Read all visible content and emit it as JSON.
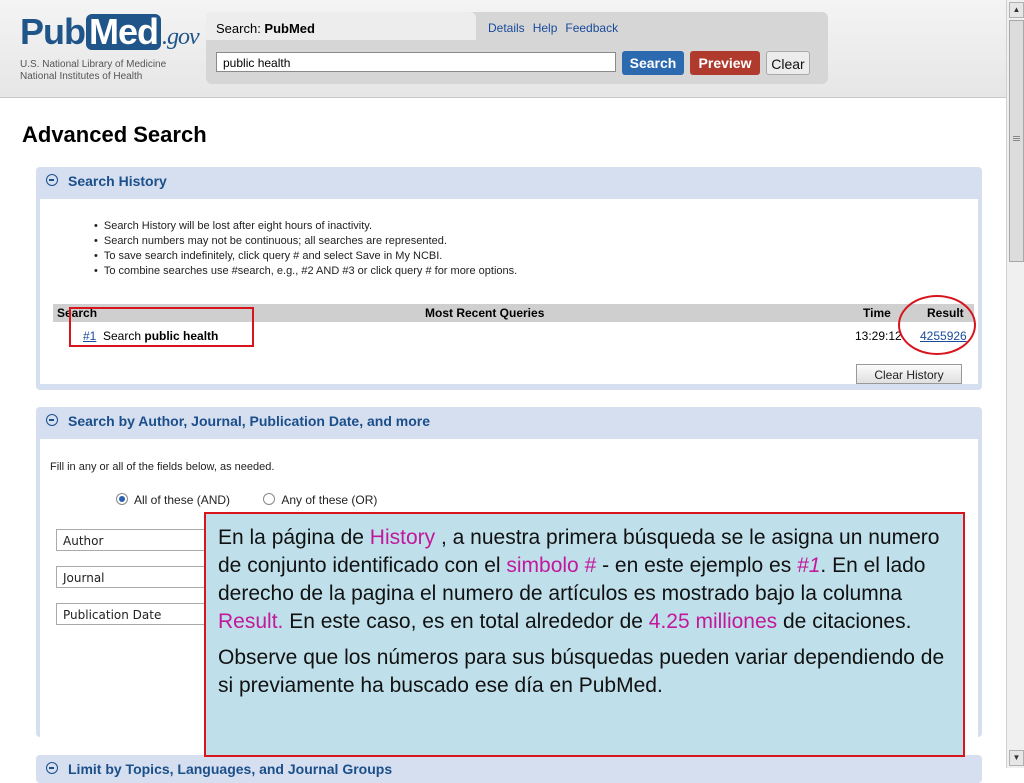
{
  "header": {
    "logo": {
      "pub": "Pub",
      "med": "Med",
      "gov": ".gov",
      "sub1": "U.S. National Library of Medicine",
      "sub2": "National Institutes of Health"
    },
    "search": {
      "label_prefix": "Search: ",
      "database": "PubMed",
      "links": [
        "Details",
        "Help",
        "Feedback"
      ],
      "query": "public health",
      "buttons": {
        "search": "Search",
        "preview": "Preview",
        "clear": "Clear"
      }
    }
  },
  "page_title": "Advanced Search",
  "search_history": {
    "title": "Search History",
    "notes": [
      "Search History will be lost after eight hours of inactivity.",
      "Search numbers may not be continuous; all searches are represented.",
      "To save search indefinitely, click query # and select Save in My NCBI.",
      "To combine searches use #search, e.g., #2 AND #3 or click query # for more options."
    ],
    "columns": {
      "search": "Search",
      "queries": "Most Recent Queries",
      "time": "Time",
      "result": "Result"
    },
    "rows": [
      {
        "number": "#1",
        "query_prefix": "Search ",
        "query_term": "public health",
        "time": "13:29:12",
        "result": "4255926"
      }
    ],
    "clear_button": "Clear History"
  },
  "author_section": {
    "title": "Search by Author, Journal, Publication Date, and more",
    "instructions": "Fill in any or all of the fields below, as needed.",
    "options": [
      {
        "label": "All of these (AND)",
        "selected": true
      },
      {
        "label": "Any of these (OR)",
        "selected": false
      }
    ],
    "fields": [
      "Author",
      "Journal",
      "Publication Date"
    ]
  },
  "limits_section": {
    "title": "Limit by Topics, Languages, and Journal Groups"
  },
  "callout": {
    "p1": [
      {
        "text": "En la página de ",
        "hl": false
      },
      {
        "text": "History",
        "hl": true
      },
      {
        "text": " , a nuestra primera búsqueda se le asigna un numero de conjunto identificado con el ",
        "hl": false
      },
      {
        "text": "simbolo #",
        "hl": true
      },
      {
        "text": " -  en este ejemplo es ",
        "hl": false
      },
      {
        "text": "#1",
        "hl": true,
        "italic": true
      },
      {
        "text": ". En el lado derecho de la pagina el numero de artículos es mostrado bajo la columna ",
        "hl": false
      },
      {
        "text": "Result.",
        "hl": true
      },
      {
        "text": " En este caso, es en total alrededor de ",
        "hl": false
      },
      {
        "text": "4.25 milliones",
        "hl": true
      },
      {
        "text": "  de citaciones.",
        "hl": false
      }
    ],
    "p2": "Observe que los números para sus búsquedas pueden variar dependiendo de si previamente ha buscado ese día en PubMed."
  },
  "colors": {
    "highlight": "#c2189b",
    "callout_bg": "#bfe0ea",
    "annotation_red": "#d8141c",
    "section_bg": "#d5dff0",
    "link": "#1a4a9a"
  }
}
